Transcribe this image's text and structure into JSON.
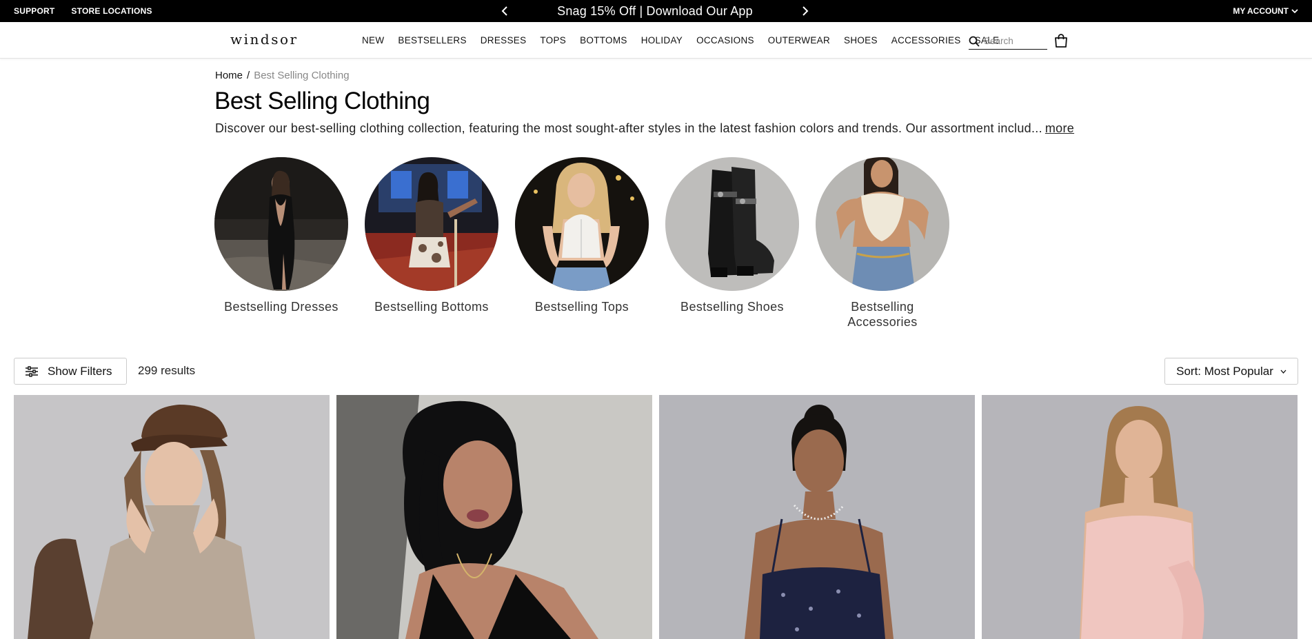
{
  "promo": {
    "support": "SUPPORT",
    "store_locations": "STORE LOCATIONS",
    "message": "Snag 15% Off | Download Our App",
    "my_account": "MY ACCOUNT"
  },
  "nav": {
    "logo": "windsor",
    "links": [
      "NEW",
      "BESTSELLERS",
      "DRESSES",
      "TOPS",
      "BOTTOMS",
      "HOLIDAY",
      "OCCASIONS",
      "OUTERWEAR",
      "SHOES",
      "ACCESSORIES",
      "SALE"
    ],
    "search_placeholder": "Search"
  },
  "breadcrumb": {
    "home": "Home",
    "separator": "/",
    "current": "Best Selling Clothing"
  },
  "page": {
    "title": "Best Selling Clothing",
    "description": "Discover our best-selling clothing collection, featuring the most sought-after styles in the latest fashion colors and trends. Our assortment includ...",
    "more_label": "more"
  },
  "categories": [
    {
      "label": "Bestselling Dresses"
    },
    {
      "label": "Bestselling Bottoms"
    },
    {
      "label": "Bestselling Tops"
    },
    {
      "label": "Bestselling Shoes"
    },
    {
      "label": "Bestselling Accessories"
    }
  ],
  "toolbar": {
    "show_filters": "Show Filters",
    "results": "299 results",
    "sort": "Sort: Most Popular"
  },
  "products": [
    {
      "name": "taupe-sweater-dress-photo"
    },
    {
      "name": "black-halter-top-photo"
    },
    {
      "name": "navy-beaded-top-photo"
    },
    {
      "name": "pink-strapless-dress-photo"
    }
  ]
}
